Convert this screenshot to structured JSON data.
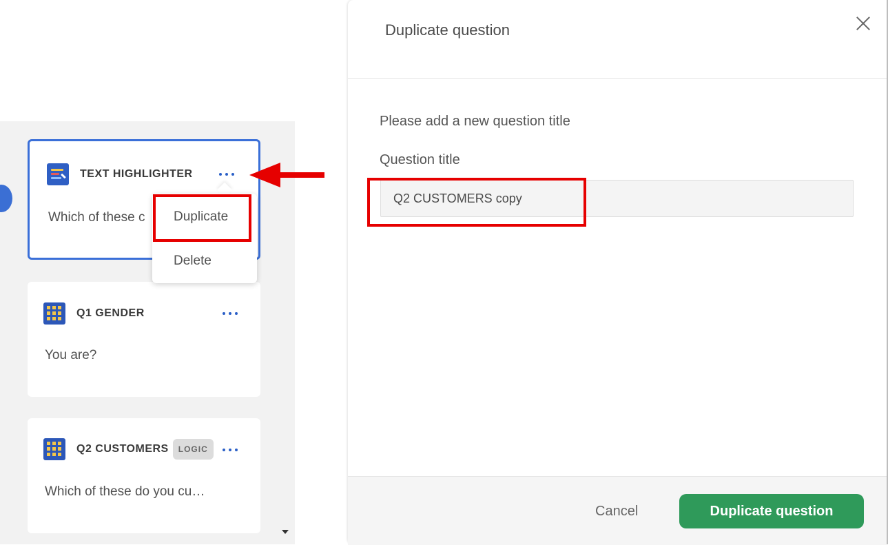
{
  "left_panel": {
    "cards": [
      {
        "title": "TEXT HIGHLIGHTER",
        "body": "Which of these c",
        "icon": "text-highlighter-icon"
      },
      {
        "title": "Q1 GENDER",
        "body": "You are?",
        "icon": "grid-question-icon"
      },
      {
        "title": "Q2 CUSTOMERS",
        "badge": "LOGIC",
        "body": "Which of these do you cu…",
        "icon": "grid-question-icon"
      }
    ],
    "menu": {
      "duplicate": "Duplicate",
      "delete": "Delete"
    }
  },
  "dialog": {
    "title": "Duplicate question",
    "instruction": "Please add a new question title",
    "field_label": "Question title",
    "field_value": "Q2 CUSTOMERS copy",
    "cancel": "Cancel",
    "confirm": "Duplicate question"
  },
  "colors": {
    "accent_blue": "#3a6fd8",
    "primary_green": "#2f9a5a",
    "annotation_red": "#e60000"
  }
}
